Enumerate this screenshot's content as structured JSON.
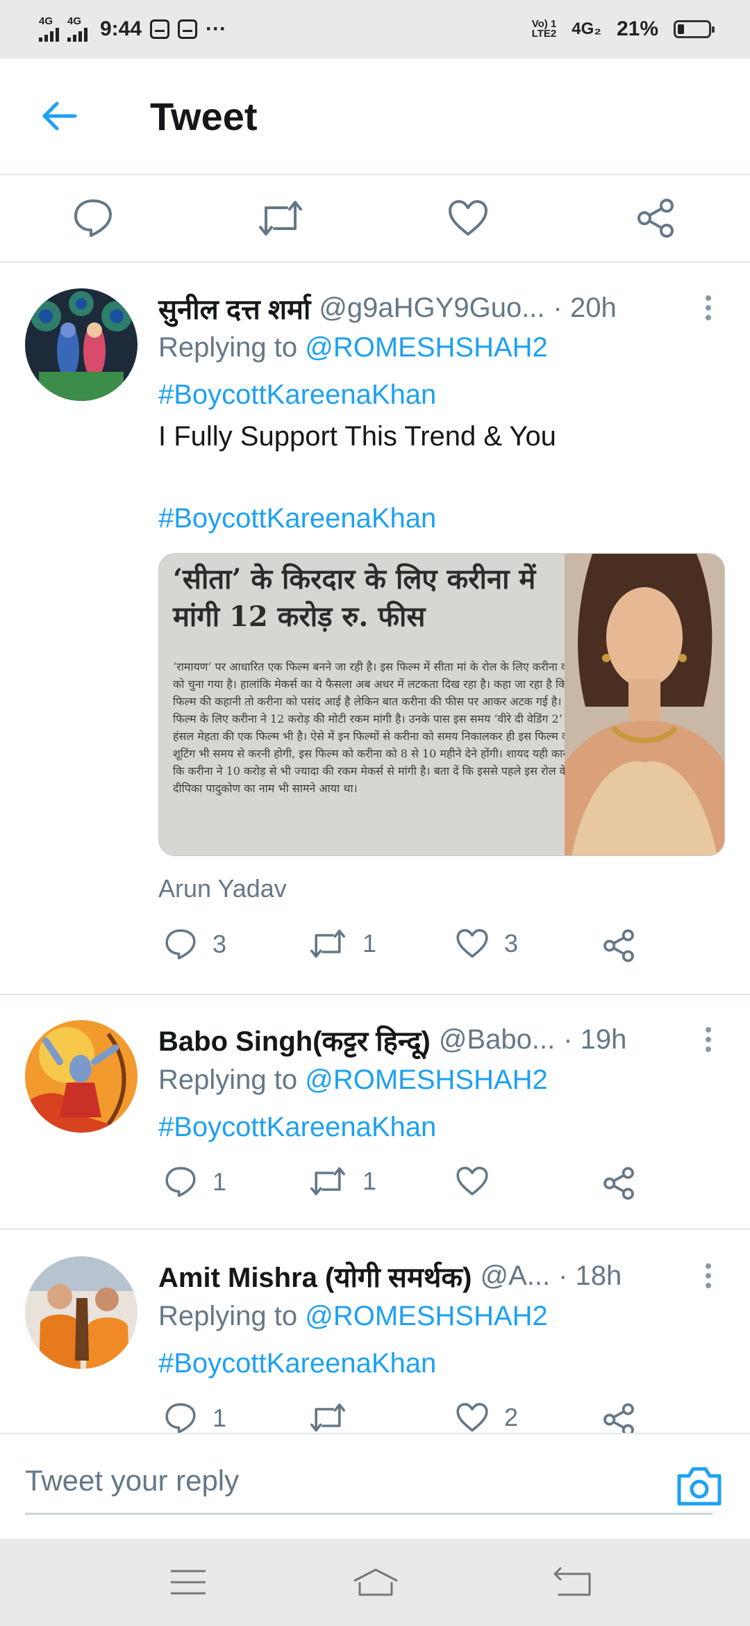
{
  "status_bar": {
    "network_left_1": "4G",
    "network_left_2": "4G",
    "time": "9:44",
    "overflow": "···",
    "volte_top": "Vo) 1",
    "volte_bottom": "LTE2",
    "network_right": "4G₂",
    "battery": "21%",
    "battery_level": 0.21
  },
  "header": {
    "back_icon": "arrow-left-icon",
    "title": "Tweet"
  },
  "main_actions": [
    "reply-icon",
    "retweet-icon",
    "like-icon",
    "share-icon"
  ],
  "colors": {
    "accent": "#1da1f2",
    "secondary_text": "#657786",
    "divider": "#e1e8ed"
  },
  "replies": [
    {
      "name": "सुनील दत्त शर्मा",
      "handle": "@g9aHGY9Guo...",
      "time": "· 20h",
      "replying_prefix": "Replying to ",
      "replying_to": "@ROMESHSHAH2",
      "hashtag": "#BoycottKareenaKhan",
      "text": "I Fully Support This Trend & You",
      "hashtag2": "#BoycottKareenaKhan",
      "image_headline": "‘सीता’ के किरदार के लिए करीना में मांगी 12 करोड़ रु. फीस",
      "image_body": "‘रामायण’ पर आधारित एक फिल्म बनने जा रही है। इस फिल्म में सीता मां के रोल के लिए करीना कपूर को चुना गया है। हालांकि मेकर्स का ये फैसला अब अधर में लटकता दिख रहा है। कहा जा रहा है कि फिल्म की कहानी तो करीना को पसंद आई है लेकिन बात करीना की फीस पर आकर अटक गई है। इस फिल्म के लिए करीना ने 12 करोड़ की मोटी रकम मांगी है। उनके पास इस समय ‘वीरे दी वेडिंग 2’ और हंसल मेहता की एक फिल्म भी है। ऐसे में इन फिल्मों से करीना को समय निकालकर ही इस फिल्म की शूटिंग भी समय से करनी होगी, इस फिल्म को करीना को 8 से 10 महीने देने होंगी। शायद यही कारण है कि करीना ने 10 करोड़ से भी ज्यादा की रकम मेकर्स से मांगी है। बता दें कि इससे पहले इस रोल के दीपिका पादुकोण का नाम भी सामने आया था।",
      "image_credit": "Arun Yadav",
      "reply_count": "3",
      "retweet_count": "1",
      "like_count": "3"
    },
    {
      "name": "Babo Singh(कट्टर हिन्दू)",
      "handle": "@Babo...",
      "time": "· 19h",
      "replying_prefix": "Replying to ",
      "replying_to": "@ROMESHSHAH2",
      "hashtag": "#BoycottKareenaKhan",
      "reply_count": "1",
      "retweet_count": "1",
      "like_count": ""
    },
    {
      "name": "Amit Mishra (योगी समर्थक)",
      "handle": "@A...",
      "time": "· 18h",
      "replying_prefix": "Replying to ",
      "replying_to": "@ROMESHSHAH2",
      "hashtag": "#BoycottKareenaKhan",
      "reply_count": "1",
      "retweet_count": "",
      "like_count": "2"
    }
  ],
  "composer": {
    "placeholder": "Tweet your reply",
    "camera_icon": "camera-icon"
  },
  "nav_bar": [
    "menu-icon",
    "home-icon",
    "back-icon"
  ]
}
